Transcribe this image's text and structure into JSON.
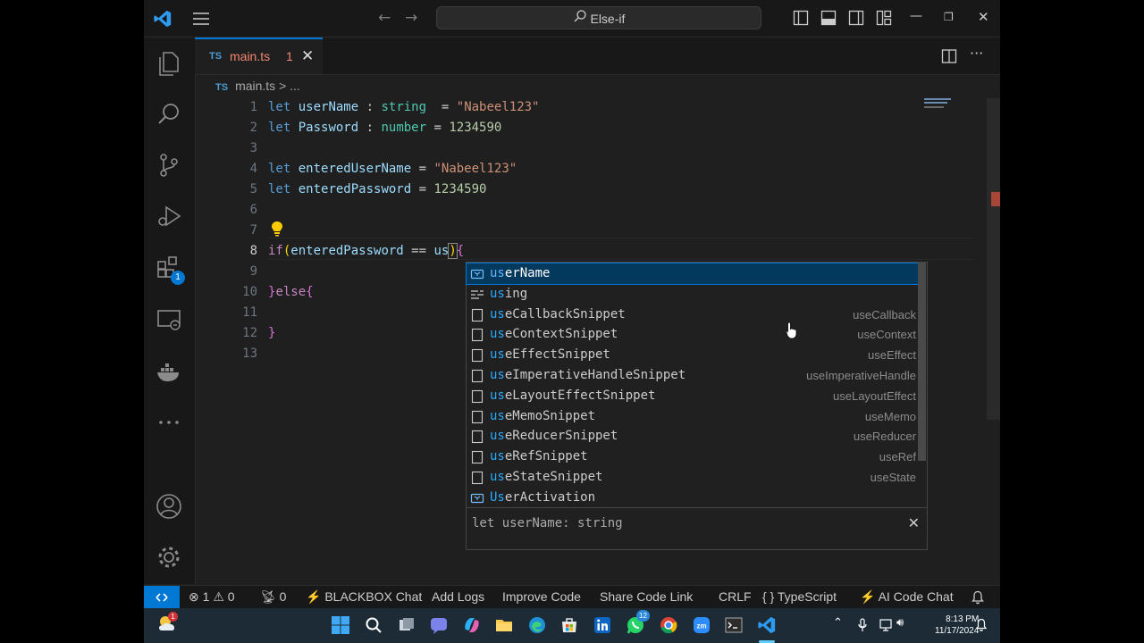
{
  "titlebar": {
    "search_text": "Else-if"
  },
  "activity": {
    "extensions_badge": "1"
  },
  "tab": {
    "lang_tag": "TS",
    "file_name": "main.ts",
    "problem_count": "1"
  },
  "breadcrumb": {
    "lang_tag": "TS",
    "file": "main.ts",
    "separator": ">",
    "rest": "..."
  },
  "editor": {
    "line_numbers": [
      "1",
      "2",
      "3",
      "4",
      "5",
      "6",
      "7",
      "8",
      "9",
      "10",
      "11",
      "12",
      "13"
    ]
  },
  "suggest": {
    "items": [
      {
        "match": "us",
        "rest": "erName",
        "detail": "",
        "kind": "variable"
      },
      {
        "match": "us",
        "rest": "ing",
        "detail": "",
        "kind": "keyword"
      },
      {
        "match": "us",
        "rest": "eCallbackSnippet",
        "detail": "useCallback",
        "kind": "snippet"
      },
      {
        "match": "us",
        "rest": "eContextSnippet",
        "detail": "useContext",
        "kind": "snippet"
      },
      {
        "match": "us",
        "rest": "eEffectSnippet",
        "detail": "useEffect",
        "kind": "snippet"
      },
      {
        "match": "us",
        "rest": "eImperativeHandleSnippet",
        "detail": "useImperativeHandle",
        "kind": "snippet"
      },
      {
        "match": "us",
        "rest": "eLayoutEffectSnippet",
        "detail": "useLayoutEffect",
        "kind": "snippet"
      },
      {
        "match": "us",
        "rest": "eMemoSnippet",
        "detail": "useMemo",
        "kind": "snippet"
      },
      {
        "match": "us",
        "rest": "eReducerSnippet",
        "detail": "useReducer",
        "kind": "snippet"
      },
      {
        "match": "us",
        "rest": "eRefSnippet",
        "detail": "useRef",
        "kind": "snippet"
      },
      {
        "match": "us",
        "rest": "eStateSnippet",
        "detail": "useState",
        "kind": "snippet"
      },
      {
        "match": "Us",
        "rest": "erActivation",
        "detail": "",
        "kind": "variable"
      }
    ],
    "detail_text": "let userName: string"
  },
  "status": {
    "errors": "1",
    "warnings": "0",
    "ports": "0",
    "blackbox": "BLACKBOX Chat",
    "add_logs": "Add Logs",
    "improve_code": "Improve Code",
    "share_code_link": "Share Code Link",
    "eol": "CRLF",
    "language_braces": "{ }",
    "language": "TypeScript",
    "ai_chat": "AI Code Chat"
  },
  "taskbar": {
    "time": "8:13 PM",
    "date": "11/17/2024",
    "teams_badge": "12",
    "widget_badge": "1"
  },
  "colors": {
    "accent": "#0078d4",
    "keyword": "#569cd6",
    "variable": "#9cdcfe",
    "type": "#4ec9b0",
    "string": "#ce9178",
    "number": "#b5cea8",
    "control": "#c586c0"
  }
}
